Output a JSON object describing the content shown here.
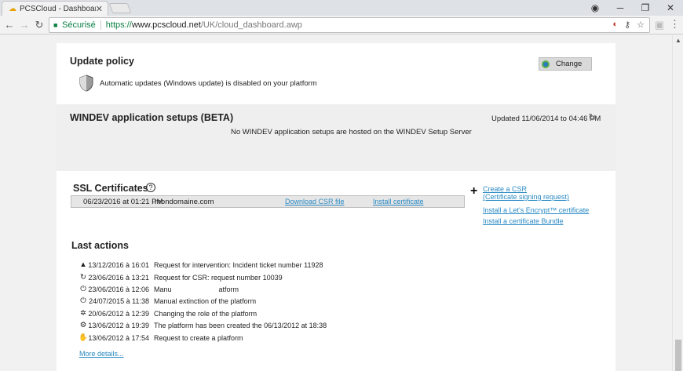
{
  "browser": {
    "tab_title": "PCSCloud - Dashboard",
    "secure_label": "Sécurisé",
    "url_scheme": "https://",
    "url_host": "www.pcscloud.net",
    "url_path": "/UK/cloud_dashboard.awp"
  },
  "update_policy": {
    "title": "Update policy",
    "text": "Automatic updates (Windows update) is disabled on your platform",
    "change_label": "Change"
  },
  "windev": {
    "title": "WINDEV application setups (BETA)",
    "updated": "Updated 11/06/2014 to 04:46 PM",
    "empty_text": "No WINDEV application setups are hosted on the WINDEV Setup Server"
  },
  "ssl": {
    "title": "SSL Certificates",
    "help": "?",
    "row_date": "06/23/2016 at 01:21 PM",
    "row_domain": "mondomaine.com",
    "download_csr": "Download CSR file",
    "install_cert": "Install certificate",
    "create_csr": "Create a CSR",
    "csr_sub": "(Certificate signing request)",
    "lets_encrypt": "Install a Let's Encrypt™ certificate",
    "bundle": "Install a certificate Bundle"
  },
  "last_actions": {
    "title": "Last actions",
    "items": [
      {
        "icon": "warning-icon",
        "date": "13/12/2016 à 16:01",
        "text": "Request for intervention: Incident ticket number 11928"
      },
      {
        "icon": "refresh-icon",
        "date": "23/06/2016 à 13:21",
        "text": "Request for CSR: request number 10039"
      },
      {
        "icon": "power-icon",
        "date": "23/06/2016 à 12:06",
        "text": "Manu                        atform"
      },
      {
        "icon": "power-icon",
        "date": "24/07/2015 à 11:38",
        "text": "Manual extinction of the platform"
      },
      {
        "icon": "gear-icon",
        "date": "20/06/2012 à 12:39",
        "text": "Changing the role of the platform"
      },
      {
        "icon": "gears-icon",
        "date": "13/06/2012 à 19:39",
        "text": "The platform has been created the 06/13/2012 at 18:38"
      },
      {
        "icon": "hand-icon",
        "date": "13/06/2012 à 17:54",
        "text": "Request to create a platform"
      }
    ],
    "more": "More details..."
  }
}
